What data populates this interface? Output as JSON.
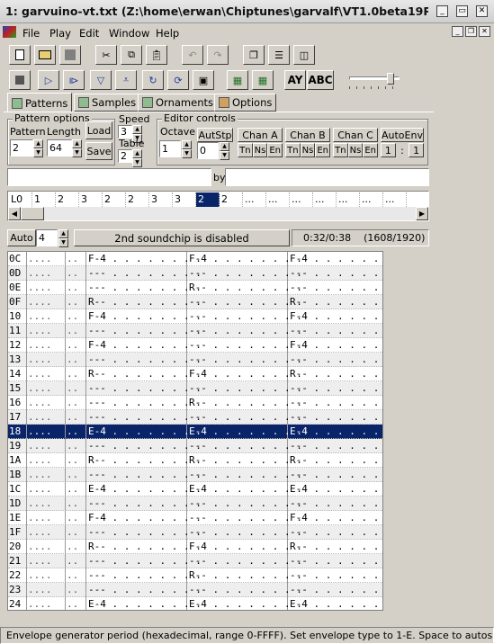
{
  "window": {
    "title": "1: garvuino-vt.txt (Z:\\home\\erwan\\Chiptunes\\garvalf\\VT1.0beta19Plu",
    "min": "_",
    "max": "▭",
    "close": "✕"
  },
  "menu": [
    "File",
    "Play",
    "Edit",
    "Window",
    "Help"
  ],
  "mdi": {
    "min": "_",
    "restore": "❐",
    "close": "✕"
  },
  "toolbar1": [
    "new-file-icon",
    "open-folder-icon",
    "save-disk-icon",
    "cut-icon",
    "copy-icon",
    "paste-icon",
    "undo-icon",
    "redo-icon",
    "tile-windows-icon",
    "split-horizontal-icon",
    "split-vertical-icon"
  ],
  "toolbar2": [
    "stop-icon",
    "play-icon",
    "play-pattern-icon",
    "play-from-line-icon",
    "play-from-start-icon",
    "loop-icon",
    "loop-all-icon",
    "toggle-sample-icon",
    "chip-ay-icon",
    "chip-ym-icon"
  ],
  "chip_buttons": {
    "ay": "AY",
    "abc": "ABC"
  },
  "volume": {
    "level": 0.88
  },
  "tabs": [
    "Patterns",
    "Samples",
    "Ornaments",
    "Options"
  ],
  "pattern_options": {
    "group": "Pattern options",
    "pattern_label": "Pattern",
    "pattern_value": "2",
    "length_label": "Length",
    "length_value": "64",
    "load": "Load",
    "save": "Save"
  },
  "speed": {
    "label": "Speed",
    "value": "3",
    "table_label": "Table",
    "table_value": "2"
  },
  "editor_controls": {
    "group": "Editor controls",
    "octave_label": "Octave",
    "octave_value": "1",
    "autostp_label": "AutStp",
    "autostp_value": "0",
    "chan_a": "Chan A",
    "chan_b": "Chan B",
    "chan_c": "Chan C",
    "tne": [
      "Tn",
      "Ns",
      "En"
    ],
    "autoenv": "AutoEnv",
    "autoenv_a": "1",
    "autoenv_sep": ":",
    "autoenv_b": "1"
  },
  "title_line": {
    "title_value": "",
    "by_label": "by",
    "author_value": ""
  },
  "order": {
    "cells": [
      "L0",
      "1",
      "2",
      "3",
      "2",
      "2",
      "3",
      "3",
      "2",
      "2",
      "...",
      "...",
      "...",
      "...",
      "...",
      "...",
      "..."
    ],
    "selected_index": 8
  },
  "info": {
    "auto_button": "Auto",
    "auto_value": "4",
    "soundchip": "2nd soundchip is disabled",
    "time": "0:32/0:38",
    "position": "(1608/1920)"
  },
  "pattern": {
    "rows": [
      {
        "ln": "0C",
        "a": "F-4",
        "b": "F-4",
        "c": "F-4"
      },
      {
        "ln": "0D",
        "a": "---",
        "b": "---",
        "c": "---"
      },
      {
        "ln": "0E",
        "a": "---",
        "b": "R--",
        "c": "---"
      },
      {
        "ln": "0F",
        "a": "R--",
        "b": "---",
        "c": "R--"
      },
      {
        "ln": "10",
        "a": "F-4",
        "b": "---",
        "c": "F-4"
      },
      {
        "ln": "11",
        "a": "---",
        "b": "---",
        "c": "---"
      },
      {
        "ln": "12",
        "a": "F-4",
        "b": "---",
        "c": "F-4"
      },
      {
        "ln": "13",
        "a": "---",
        "b": "---",
        "c": "---"
      },
      {
        "ln": "14",
        "a": "R--",
        "b": "F-4",
        "c": "R--"
      },
      {
        "ln": "15",
        "a": "---",
        "b": "---",
        "c": "---"
      },
      {
        "ln": "16",
        "a": "---",
        "b": "R--",
        "c": "---"
      },
      {
        "ln": "17",
        "a": "---",
        "b": "---",
        "c": "---"
      },
      {
        "ln": "18",
        "a": "E-4",
        "b": "E-4",
        "c": "E-4"
      },
      {
        "ln": "19",
        "a": "---",
        "b": "---",
        "c": "---"
      },
      {
        "ln": "1A",
        "a": "R--",
        "b": "R--",
        "c": "R--"
      },
      {
        "ln": "1B",
        "a": "---",
        "b": "---",
        "c": "---"
      },
      {
        "ln": "1C",
        "a": "E-4",
        "b": "E-4",
        "c": "E-4"
      },
      {
        "ln": "1D",
        "a": "---",
        "b": "---",
        "c": "---"
      },
      {
        "ln": "1E",
        "a": "F-4",
        "b": "---",
        "c": "F-4"
      },
      {
        "ln": "1F",
        "a": "---",
        "b": "---",
        "c": "---"
      },
      {
        "ln": "20",
        "a": "R--",
        "b": "F-4",
        "c": "R--"
      },
      {
        "ln": "21",
        "a": "---",
        "b": "---",
        "c": "---"
      },
      {
        "ln": "22",
        "a": "---",
        "b": "R--",
        "c": "---"
      },
      {
        "ln": "23",
        "a": "---",
        "b": "---",
        "c": "---"
      },
      {
        "ln": "24",
        "a": "E-4",
        "b": "E-4",
        "c": "E-4"
      }
    ],
    "selected_row": "18",
    "c1": "....",
    "c2": ".."
  },
  "status": "Envelope generator period (hexadecimal, range 0-FFFF). Set envelope type to 1-E. Space to autos",
  "colors": {
    "selection": "#0a246a",
    "face": "#d4d0c8"
  }
}
